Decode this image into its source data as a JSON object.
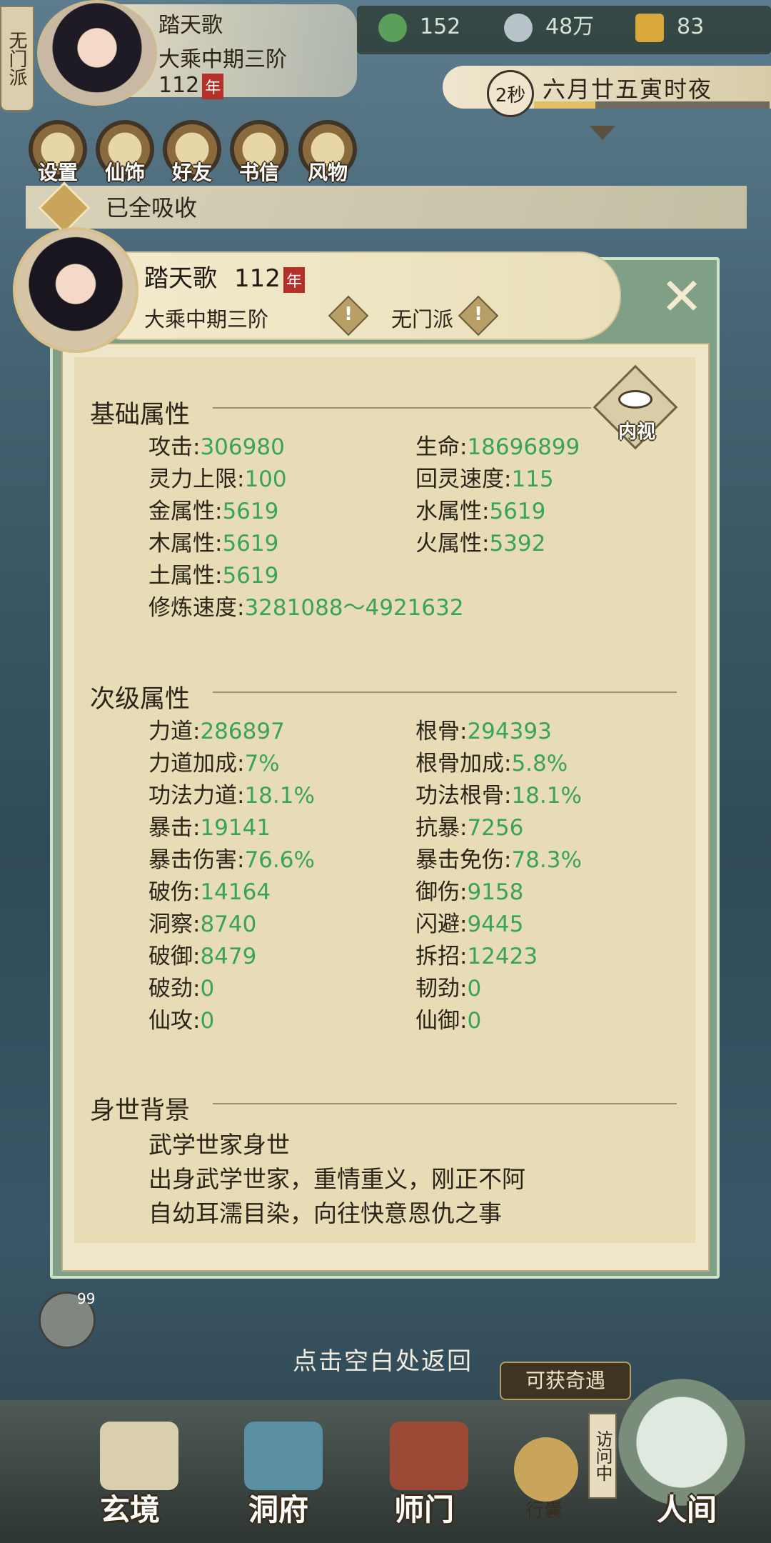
{
  "topbar": {
    "sect_tab": "无门派",
    "player_name": "踏天歌",
    "realm": "大乘中期三阶",
    "age": "112",
    "age_seal": "年",
    "resources": [
      {
        "icon": "jade-leaf-icon",
        "value": "152",
        "color": "#5aa05a"
      },
      {
        "icon": "coin-icon",
        "value": "48万",
        "color": "#b7c2c9"
      },
      {
        "icon": "gold-ingot-icon",
        "value": "83",
        "color": "#d8a93a"
      }
    ],
    "timer": "2秒",
    "date": "六月廿五寅时夜",
    "time_progress": 0.26
  },
  "menu": [
    {
      "label": "设置",
      "icon": "settings-icon"
    },
    {
      "label": "仙饰",
      "icon": "costume-icon"
    },
    {
      "label": "好友",
      "icon": "friends-icon"
    },
    {
      "label": "书信",
      "icon": "letter-icon"
    },
    {
      "label": "风物",
      "icon": "scenery-icon"
    }
  ],
  "absorb_bar": {
    "text": "已全吸收"
  },
  "panel": {
    "name": "踏天歌",
    "age": "112",
    "age_seal": "年",
    "realm": "大乘中期三阶",
    "sect": "无门派",
    "eye_label": "内视",
    "basic": {
      "title": "基础属性",
      "attrs": [
        {
          "label": "攻击:",
          "value": "306980"
        },
        {
          "label": "生命:",
          "value": "18696899"
        },
        {
          "label": "灵力上限:",
          "value": "100"
        },
        {
          "label": "回灵速度:",
          "value": "115"
        },
        {
          "label": "金属性:",
          "value": "5619"
        },
        {
          "label": "水属性:",
          "value": "5619"
        },
        {
          "label": "木属性:",
          "value": "5619"
        },
        {
          "label": "火属性:",
          "value": "5392"
        },
        {
          "label": "土属性:",
          "value": "5619"
        },
        {
          "label": "修炼速度:",
          "value": "3281088～4921632"
        }
      ]
    },
    "secondary": {
      "title": "次级属性",
      "attrs": [
        {
          "label": "力道:",
          "value": "286897"
        },
        {
          "label": "根骨:",
          "value": "294393"
        },
        {
          "label": "力道加成:",
          "value": "7%"
        },
        {
          "label": "根骨加成:",
          "value": "5.8%"
        },
        {
          "label": "功法力道:",
          "value": "18.1%"
        },
        {
          "label": "功法根骨:",
          "value": "18.1%"
        },
        {
          "label": "暴击:",
          "value": "19141"
        },
        {
          "label": "抗暴:",
          "value": "7256"
        },
        {
          "label": "暴击伤害:",
          "value": "76.6%"
        },
        {
          "label": "暴击免伤:",
          "value": "78.3%"
        },
        {
          "label": "破伤:",
          "value": "14164"
        },
        {
          "label": "御伤:",
          "value": "9158"
        },
        {
          "label": "洞察:",
          "value": "8740"
        },
        {
          "label": "闪避:",
          "value": "9445"
        },
        {
          "label": "破御:",
          "value": "8479"
        },
        {
          "label": "拆招:",
          "value": "12423"
        },
        {
          "label": "破劲:",
          "value": "0"
        },
        {
          "label": "韧劲:",
          "value": "0"
        },
        {
          "label": "仙攻:",
          "value": "0"
        },
        {
          "label": "仙御:",
          "value": "0"
        }
      ]
    },
    "background": {
      "title": "身世背景",
      "lines": [
        "武学世家身世",
        "出身武学世家，重情重义，刚正不阿",
        "自幼耳濡目染，向往快意恩仇之事"
      ]
    }
  },
  "bottom": {
    "chat_badge": "99",
    "return_hint": "点击空白处返回",
    "encounter": "可获奇遇",
    "visit_tag": "访问中",
    "nav": [
      {
        "label": "玄境",
        "icon": "scroll-icon"
      },
      {
        "label": "洞府",
        "icon": "pavilion-icon"
      },
      {
        "label": "师门",
        "icon": "banner-icon"
      },
      {
        "label": "行囊",
        "icon": "bag-icon"
      },
      {
        "label": "人间",
        "icon": "world-icon"
      }
    ]
  },
  "colors": {
    "accent_green": "#3aa35a",
    "seal_red": "#b6302a"
  }
}
